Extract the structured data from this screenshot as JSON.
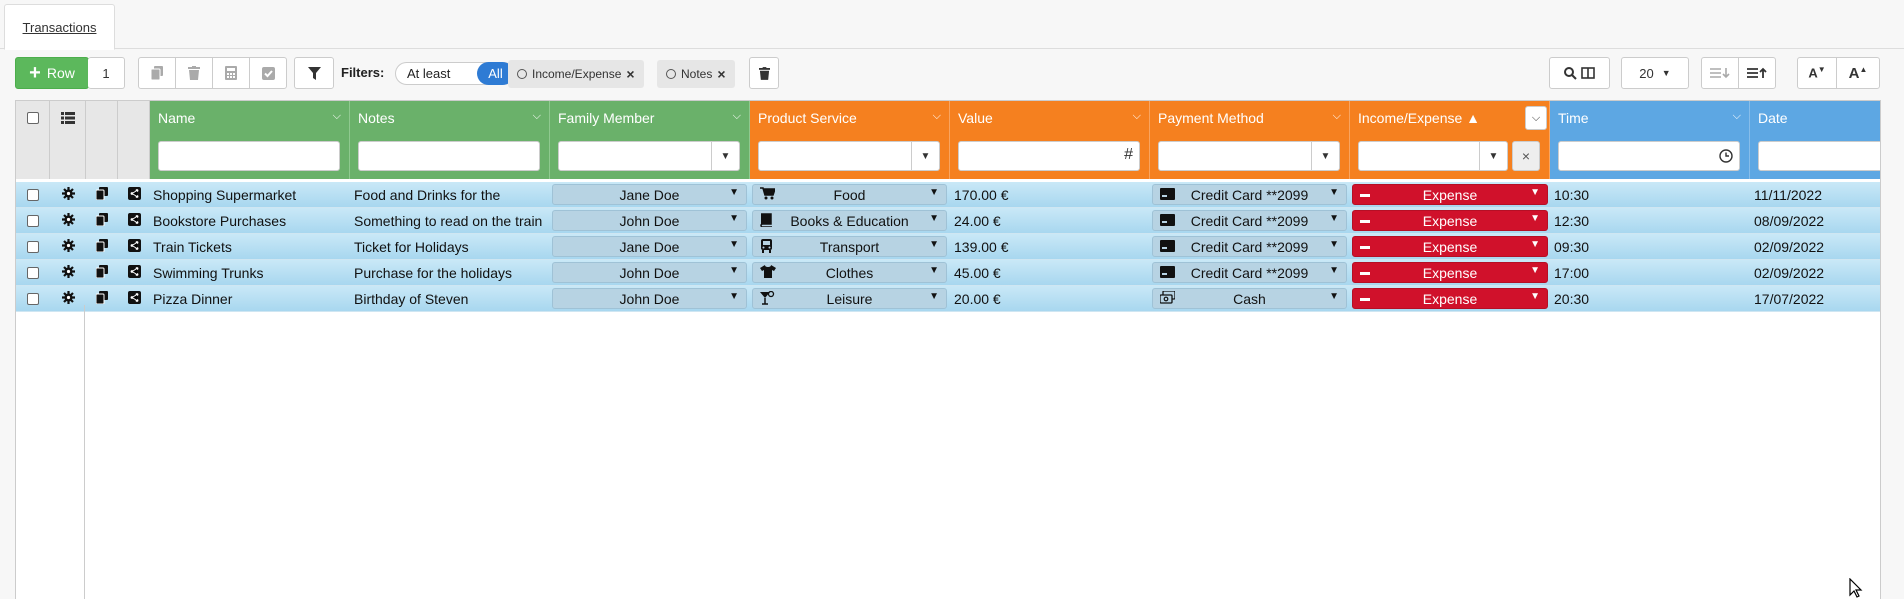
{
  "tab": {
    "label": "Transactions"
  },
  "toolbar": {
    "add_row_label": "Row",
    "row_count": "1",
    "filters_label": "Filters:",
    "match_options": [
      "At least",
      "All"
    ],
    "chips": [
      "Income/Expense",
      "Notes"
    ],
    "page_size": "20"
  },
  "columns": [
    {
      "label": "Name",
      "color": "#6ab16a"
    },
    {
      "label": "Notes",
      "color": "#6ab16a"
    },
    {
      "label": "Family Member",
      "color": "#6ab16a"
    },
    {
      "label": "Product Service",
      "color": "#f5801f"
    },
    {
      "label": "Value",
      "color": "#f5801f"
    },
    {
      "label": "Payment Method",
      "color": "#f5801f"
    },
    {
      "label": "Income/Expense ▲",
      "color": "#f5801f"
    },
    {
      "label": "Time",
      "color": "#5da7e3"
    },
    {
      "label": "Date",
      "color": "#5da7e3"
    }
  ],
  "rows": [
    {
      "name": "Shopping Supermarket",
      "notes": "Food and Drinks for the",
      "member": "Jane Doe",
      "product": "Food",
      "product_icon": "cart-icon",
      "value": "170.00 €",
      "payment": "Credit Card **2099",
      "payment_icon": "credit-card-icon",
      "type": "Expense",
      "time": "10:30",
      "date": "11/11/2022"
    },
    {
      "name": "Bookstore Purchases",
      "notes": "Something to read on the train",
      "member": "John Doe",
      "product": "Books & Education",
      "product_icon": "book-icon",
      "value": "24.00 €",
      "payment": "Credit Card **2099",
      "payment_icon": "credit-card-icon",
      "type": "Expense",
      "time": "12:30",
      "date": "08/09/2022"
    },
    {
      "name": "Train Tickets",
      "notes": "Ticket for Holidays",
      "member": "Jane Doe",
      "product": "Transport",
      "product_icon": "bus-icon",
      "value": "139.00 €",
      "payment": "Credit Card **2099",
      "payment_icon": "credit-card-icon",
      "type": "Expense",
      "time": "09:30",
      "date": "02/09/2022"
    },
    {
      "name": "Swimming Trunks",
      "notes": "Purchase for the holidays",
      "member": "John Doe",
      "product": "Clothes",
      "product_icon": "tshirt-icon",
      "value": "45.00 €",
      "payment": "Credit Card **2099",
      "payment_icon": "credit-card-icon",
      "type": "Expense",
      "time": "17:00",
      "date": "02/09/2022"
    },
    {
      "name": "Pizza Dinner",
      "notes": "Birthday of Steven",
      "member": "John Doe",
      "product": "Leisure",
      "product_icon": "cocktail-icon",
      "value": "20.00 €",
      "payment": "Cash",
      "payment_icon": "cash-icon",
      "type": "Expense",
      "time": "20:30",
      "date": "17/07/2022"
    }
  ],
  "colors": {
    "add_row": "#5cb85c",
    "active_toggle": "#2e7bd4",
    "expense": "#d0112b",
    "row_stripe": "#b9dff2"
  }
}
